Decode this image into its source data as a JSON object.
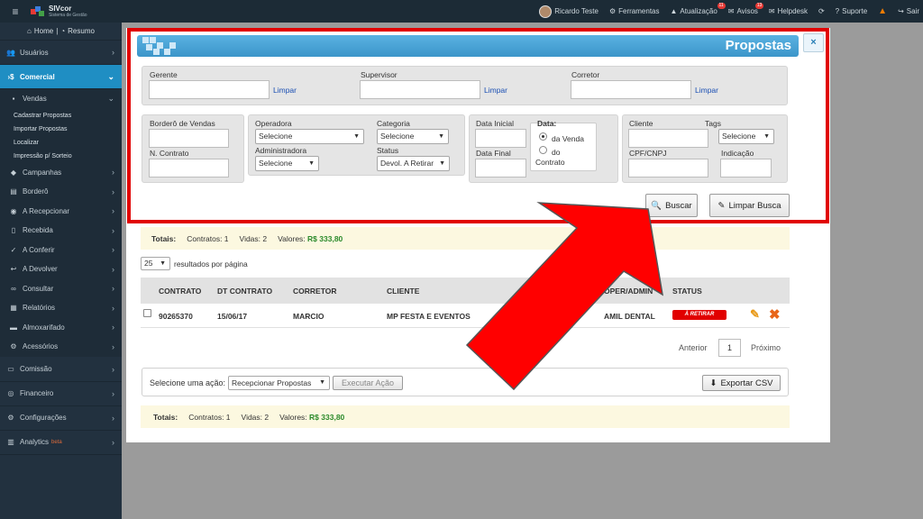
{
  "topbar": {
    "brand": "SIVcor",
    "brand_sub": "Sistema de Gestão",
    "user": "Ricardo Teste",
    "ferramentas": "Ferramentas",
    "atualizacao": "Atualização",
    "atualizacao_count": "11",
    "avisos": "Avisos",
    "avisos_count": "13",
    "helpdesk": "Helpdesk",
    "suporte": "Suporte",
    "sair": "Sair"
  },
  "sidebar": {
    "home": "Home",
    "resumo": "Resumo",
    "usuarios": "Usuários",
    "comercial": "Comercial",
    "vendas": "Vendas",
    "vendas_items": [
      "Cadastrar Propostas",
      "Importar Propostas",
      "Localizar",
      "Impressão p/ Sorteio"
    ],
    "sub_items": [
      "Campanhas",
      "Borderô",
      "A Recepcionar",
      "Recebida",
      "A Conferir",
      "A Devolver",
      "Consultar",
      "Relatórios",
      "Almoxarifado",
      "Acessórios"
    ],
    "comissao": "Comissão",
    "financeiro": "Financeiro",
    "configuracoes": "Configurações",
    "analytics": "Analytics",
    "beta": "beta"
  },
  "modal": {
    "title": "Propostas",
    "close": "×",
    "gerente": "Gerente",
    "supervisor": "Supervisor",
    "corretor": "Corretor",
    "limpar": "Limpar",
    "bordero": "Borderô de Vendas",
    "n_contrato": "N. Contrato",
    "operadora": "Operadora",
    "operadora_value": "Selecione",
    "administradora": "Administradora",
    "administradora_value": "Selecione",
    "categoria": "Categoria",
    "categoria_value": "Selecione",
    "status": "Status",
    "status_value": "Devol. A Retirar",
    "data_inicial": "Data Inicial",
    "data_final": "Data Final",
    "data": "Data:",
    "da_venda": "da Venda",
    "do": "do",
    "contrato": "Contrato",
    "cliente": "Cliente",
    "tags": "Tags",
    "tags_value": "Selecione",
    "cpf": "CPF/CNPJ",
    "indicacao": "Indicação",
    "buscar": "Buscar",
    "limpar_busca": "Limpar Busca"
  },
  "totals": {
    "label": "Totais:",
    "contratos": "Contratos: 1",
    "vidas": "Vidas: 2",
    "valores": "Valores:",
    "valor": "R$ 333,80"
  },
  "results": {
    "per_page": "25",
    "per_page_label": "resultados por página"
  },
  "table": {
    "headers": [
      "CONTRATO",
      "DT CONTRATO",
      "CORRETOR",
      "CLIENTE",
      "OPER/ADMIN",
      "STATUS"
    ],
    "rows": [
      {
        "contrato": "90265370",
        "dt": "15/06/17",
        "corretor": "MARCIO",
        "cliente": "MP FESTA E EVENTOS",
        "oper": "AMIL DENTAL",
        "status": "À RETIRAR"
      }
    ]
  },
  "pagination": {
    "prev": "Anterior",
    "page": "1",
    "next": "Próximo"
  },
  "actions": {
    "label": "Selecione uma ação:",
    "select": "Recepcionar Propostas",
    "execute": "Executar Ação",
    "export": "Exportar CSV"
  },
  "colors": {
    "accent": "#1f8ec3",
    "highlight": "#e10000",
    "arrow": "#ff0000"
  }
}
